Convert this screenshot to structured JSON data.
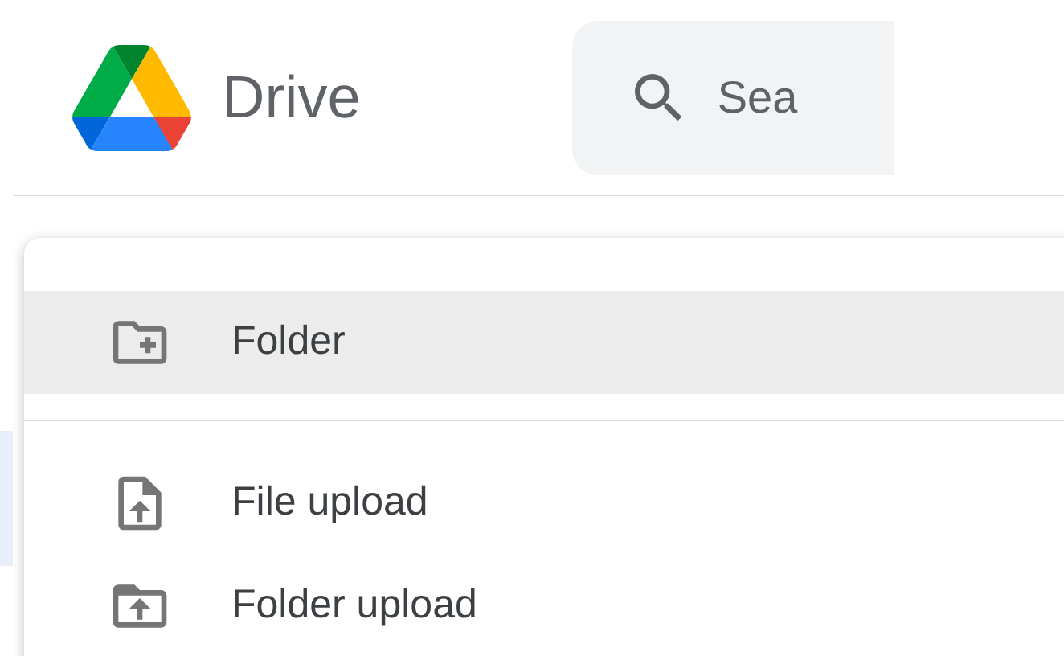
{
  "header": {
    "app_name": "Drive",
    "search": {
      "placeholder": "Sea"
    }
  },
  "new_menu": {
    "groups": [
      [
        {
          "kind": "new-folder",
          "label": "Folder",
          "selected": true
        }
      ],
      [
        {
          "kind": "file-upload",
          "label": "File upload",
          "selected": false
        },
        {
          "kind": "folder-upload",
          "label": "Folder upload",
          "selected": false
        }
      ]
    ]
  }
}
